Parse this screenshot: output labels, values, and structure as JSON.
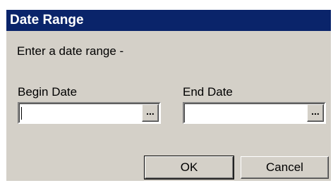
{
  "dialog": {
    "title": "Date Range",
    "prompt": "Enter a date range -",
    "begin_date": {
      "label": "Begin Date",
      "value": "",
      "picker_label": "..."
    },
    "end_date": {
      "label": "End Date",
      "value": "",
      "picker_label": "..."
    },
    "ok_label": "OK",
    "cancel_label": "Cancel"
  },
  "colors": {
    "titlebar": "#0a246a",
    "dialog_face": "#d4d0c8"
  }
}
